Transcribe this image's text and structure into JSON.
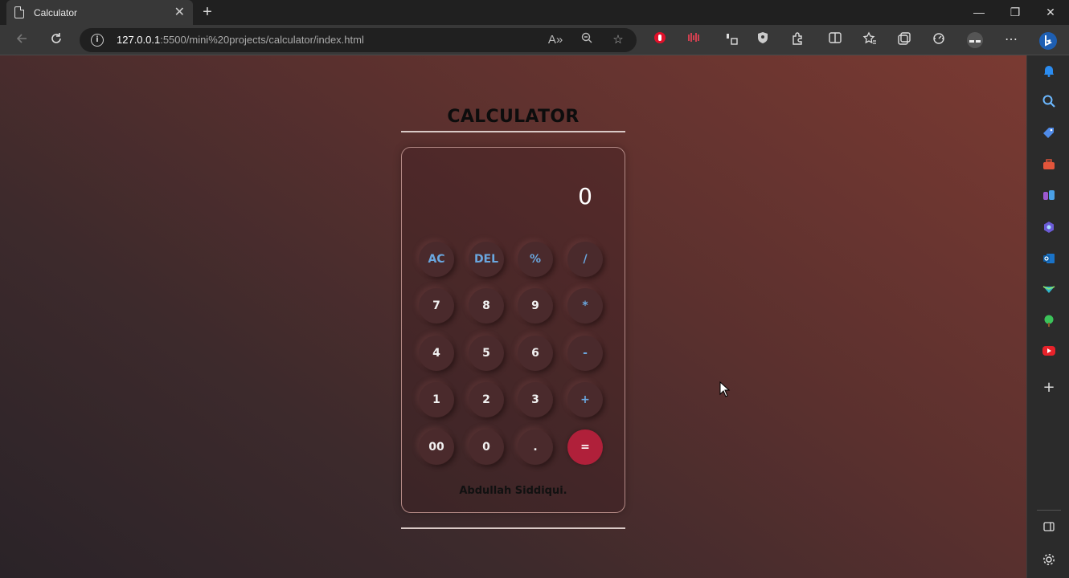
{
  "browser": {
    "tab": {
      "title": "Calculator",
      "close": "✕"
    },
    "new_tab": "+",
    "window_controls": {
      "minimize": "—",
      "restore": "❐",
      "close": "✕"
    },
    "address": {
      "host": "127.0.0.1",
      "rest": ":5500/mini%20projects/calculator/index.html"
    },
    "toolbar_icons": [
      "back-icon",
      "refresh-icon",
      "read-aloud-icon",
      "zoom-icon",
      "favorite-star-icon",
      "extension-red-icon",
      "extension-audio-icon",
      "extension-tab-icon",
      "shield-icon",
      "extensions-icon",
      "split-screen-icon",
      "favorites-icon",
      "collections-icon",
      "performance-icon",
      "profile-icon",
      "more-icon",
      "bing-copilot-icon"
    ]
  },
  "page": {
    "title": "CALCULATOR",
    "display": "0",
    "credit": "Abdullah Siddiqui.",
    "keys": [
      [
        "AC",
        "DEL",
        "%",
        "/"
      ],
      [
        "7",
        "8",
        "9",
        "*"
      ],
      [
        "4",
        "5",
        "6",
        "-"
      ],
      [
        "1",
        "2",
        "3",
        "+"
      ],
      [
        "00",
        "0",
        ".",
        "="
      ]
    ]
  },
  "sidebar_icons": [
    "notification-bell-icon",
    "search-icon",
    "shopping-tag-icon",
    "tools-briefcase-icon",
    "games-icon",
    "copilot-icon",
    "outlook-icon",
    "drop-icon",
    "tree-icon",
    "youtube-icon",
    "add-icon",
    "hide-sidebar-icon",
    "settings-gear-icon"
  ],
  "colors": {
    "operator_text": "#6aa7df",
    "equals_button": "#b0203a",
    "browser_chrome": "#202020",
    "page_gradient_end": "#7a3a32"
  }
}
